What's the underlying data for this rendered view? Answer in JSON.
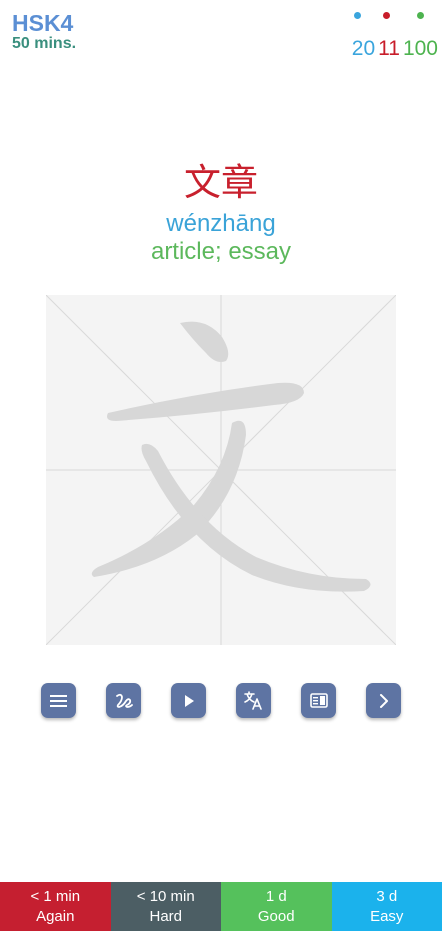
{
  "header": {
    "deck_title": "HSK4",
    "time_left": "50 mins.",
    "counts": [
      {
        "value": "20",
        "color": "#3aa5dd"
      },
      {
        "value": "11",
        "color": "#c81d2a"
      },
      {
        "value": "100",
        "color": "#4db34f"
      }
    ]
  },
  "card": {
    "hanzi": "文章",
    "pinyin": "wénzhāng",
    "meaning": "article; essay",
    "colors": {
      "hanzi": "#c8202d",
      "pinyin": "#3aa3d8",
      "meaning": "#5cb85c"
    }
  },
  "writing_area": {
    "character": "文"
  },
  "toolbar": {
    "buttons": [
      {
        "icon": "menu-icon"
      },
      {
        "icon": "stroke-order-icon"
      },
      {
        "icon": "play-icon"
      },
      {
        "icon": "translate-icon"
      },
      {
        "icon": "dictionary-icon"
      },
      {
        "icon": "chevron-right-icon"
      }
    ],
    "color": "#5e74a3"
  },
  "grade_buttons": [
    {
      "interval": "< 1 min",
      "label": "Again",
      "color": "#c51f30"
    },
    {
      "interval": "< 10 min",
      "label": "Hard",
      "color": "#4c5e64"
    },
    {
      "interval": "1 d",
      "label": "Good",
      "color": "#55c15c"
    },
    {
      "interval": "3 d",
      "label": "Easy",
      "color": "#1bb2ec"
    }
  ]
}
